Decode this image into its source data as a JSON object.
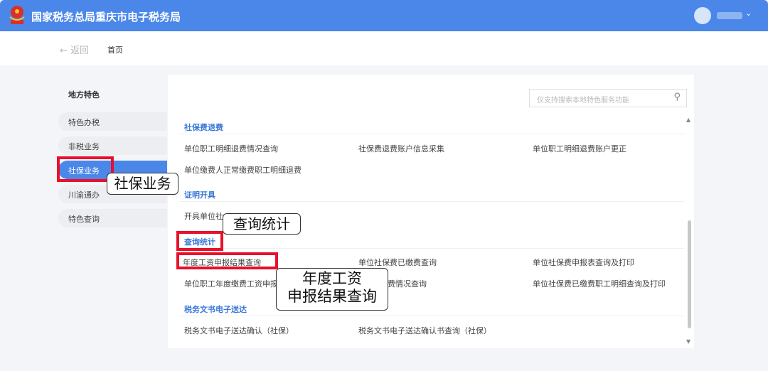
{
  "header": {
    "title": "国家税务总局重庆市电子税务局",
    "colors": {
      "brand": "#4a87e9",
      "highlight": "#e8102a"
    }
  },
  "breadcrumb": {
    "back": "← 返回",
    "home": "首页"
  },
  "sidebar": {
    "title": "地方特色",
    "items": [
      {
        "label": "特色办税"
      },
      {
        "label": "非税业务"
      },
      {
        "label": "社保业务"
      },
      {
        "label": "川渝通办"
      },
      {
        "label": "特色查询"
      }
    ]
  },
  "search": {
    "placeholder": "仅支持搜索本地特色服务功能"
  },
  "sections": [
    {
      "title": "社保费退费",
      "items": [
        "单位职工明细退费情况查询",
        "社保费退费账户信息采集",
        "单位职工明细退费账户更正",
        "单位缴费人正常缴费职工明细退费"
      ]
    },
    {
      "title": "证明开具",
      "items": [
        "开具单位社"
      ]
    },
    {
      "title": "查询统计",
      "items": [
        "年度工资申报结果查询",
        "单位社保费已缴费查询",
        "单位社保费申报表查询及打印",
        "单位职工年度缴费工资申报",
        "费情况查询",
        "单位社保费已缴费职工明细查询及打印"
      ]
    },
    {
      "title": "税务文书电子送达",
      "items": [
        "税务文书电子送达确认（社保）",
        "税务文书电子送达确认书查询（社保）"
      ]
    }
  ],
  "callouts": {
    "a": "社保业务",
    "b": "查询统计",
    "c1": "年度工资",
    "c2": "申报结果查询"
  }
}
